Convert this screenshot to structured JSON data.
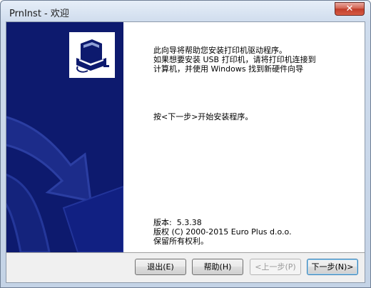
{
  "window": {
    "title": "PrnInst - 欢迎"
  },
  "content": {
    "intro": "此向导将帮助您安装打印机驱动程序。\n如果想要安装 USB 打印机，请将打印机连接到\n计算机，并使用 Windows 找到新硬件向导",
    "instruction": "按<下一步>开始安装程序。",
    "version_label": "版本:  5.3.38",
    "copyright": "版权 (C) 2000-2015 Euro Plus d.o.o.",
    "rights": "保留所有权利。"
  },
  "buttons": {
    "exit": "退出(E)",
    "help": "帮助(H)",
    "back": "<上一步(P)",
    "next": "下一步(N)>"
  },
  "colors": {
    "banner": "#0d1a6e",
    "close_button": "#c03d2a"
  },
  "icons": {
    "banner_logo": "printer-logo-icon",
    "close": "close-icon"
  }
}
